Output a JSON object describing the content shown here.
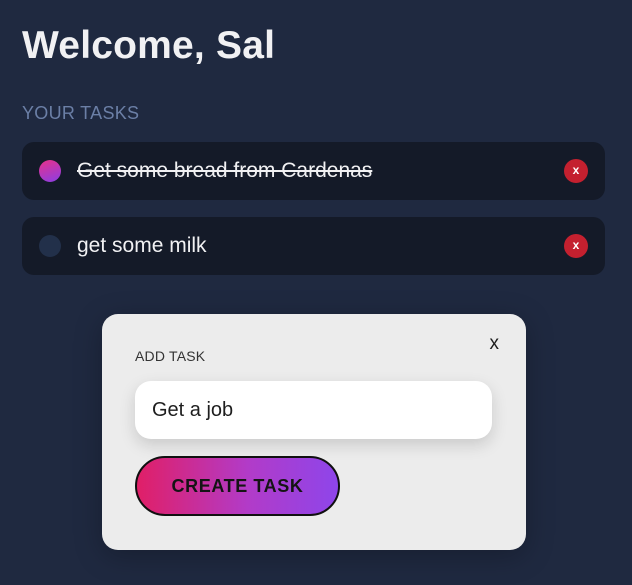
{
  "header": {
    "welcome_text": "Welcome, Sal",
    "section_label": "YOUR TASKS"
  },
  "tasks": [
    {
      "text": "Get some bread from Cardenas",
      "completed": true,
      "delete_label": "x"
    },
    {
      "text": "get some milk",
      "completed": false,
      "delete_label": "x"
    }
  ],
  "add_task_modal": {
    "close_label": "x",
    "label": "ADD TASK",
    "input_value": "Get a job",
    "submit_label": "CREATE TASK"
  },
  "colors": {
    "background": "#1f2940",
    "task_card": "#141a28",
    "delete_button": "#c4202f",
    "gradient_start": "#e01f67",
    "gradient_end": "#8e45ea"
  }
}
